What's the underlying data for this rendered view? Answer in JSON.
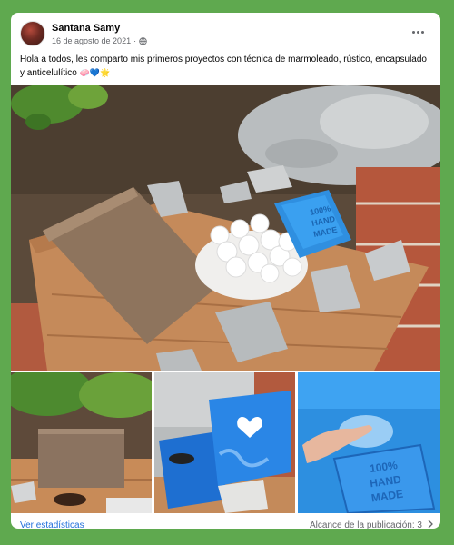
{
  "post": {
    "author": "Santana Samy",
    "date": "16 de agosto de 2021",
    "separator": "·",
    "text": "Hola a todos, les comparto mis primeros proyectos con técnica de marmoleado, rústico, encapsulado y anticelulítico",
    "emojis": "🧼💙🌟",
    "more_icon": "more-dots-icon",
    "privacy_icon": "globe-icon"
  },
  "photos": {
    "soap_label_lines": [
      "100%",
      "HAND",
      "MADE"
    ]
  },
  "footer": {
    "stats_link": "Ver estadísticas",
    "reach_label": "Alcance de la publicación: 3"
  },
  "colors": {
    "page_background": "#5fa94f",
    "link": "#216fdb",
    "soap_blue": "#2f8fe0"
  }
}
